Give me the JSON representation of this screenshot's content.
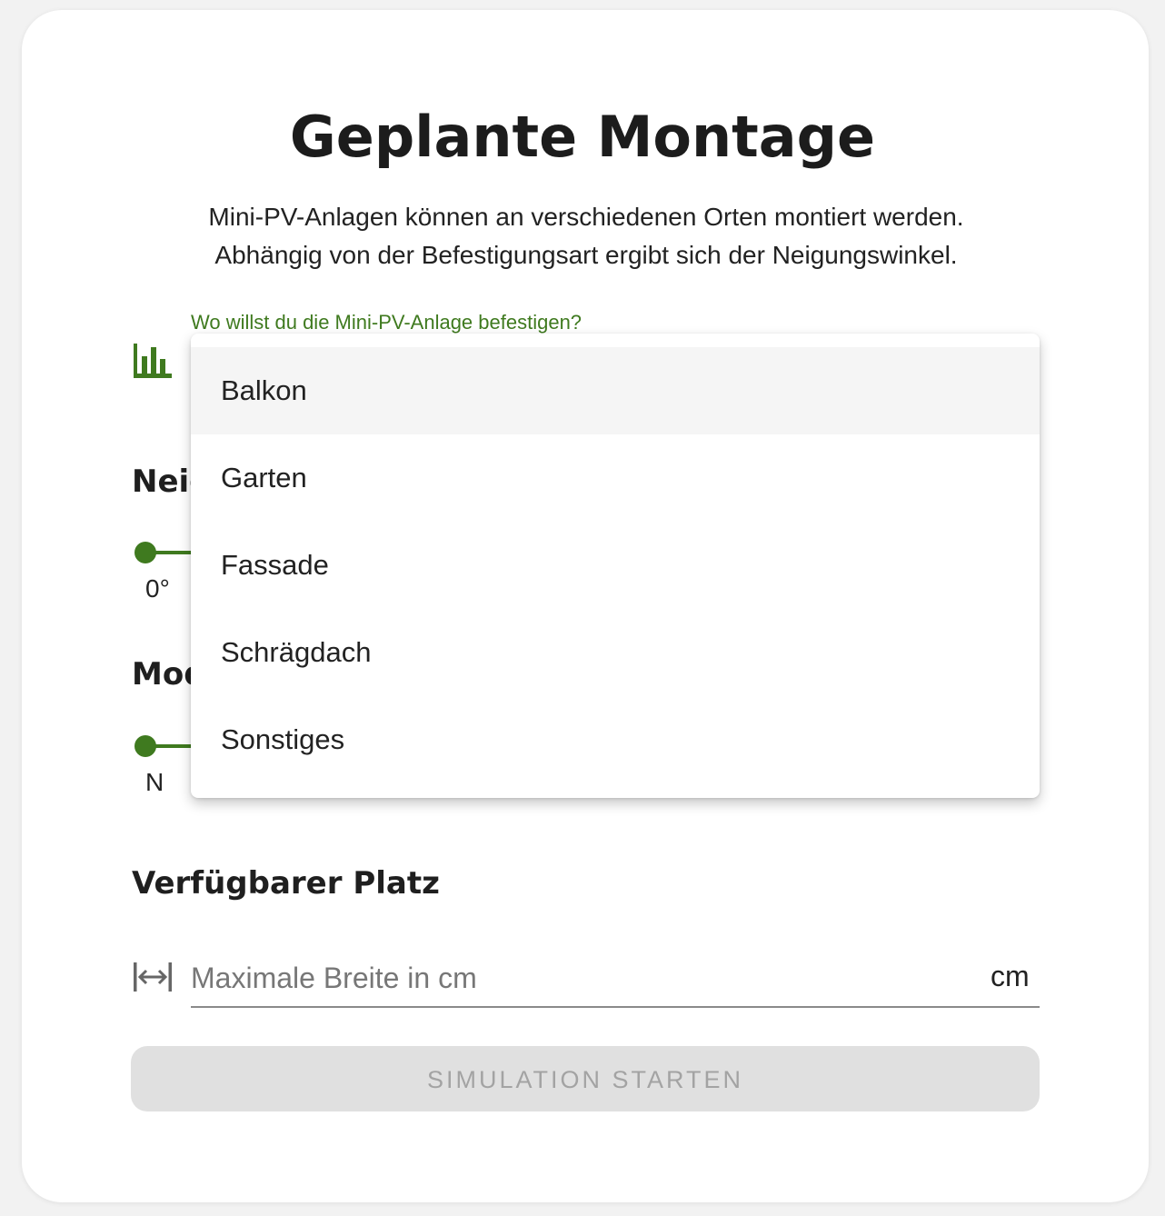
{
  "header": {
    "title": "Geplante Montage",
    "subtitle_line1": "Mini-PV-Anlagen können an verschiedenen Orten montiert werden.",
    "subtitle_line2": "Abhängig von der Befestigungsart ergibt sich der Neigungswinkel."
  },
  "mounting": {
    "label": "Wo willst du die Mini-PV-Anlage befestigen?",
    "icon": "bar-chart-icon",
    "options": [
      "Balkon",
      "Garten",
      "Fassade",
      "Schrägdach",
      "Sonstiges"
    ],
    "highlighted": "Balkon"
  },
  "tilt": {
    "heading_visible": "Neig",
    "min_label": "0°"
  },
  "orientation": {
    "heading_visible": "Mod",
    "min_label": "N"
  },
  "space": {
    "heading": "Verfügbarer Platz",
    "icon": "width-arrows-icon",
    "placeholder": "Maximale Breite in cm",
    "unit": "cm"
  },
  "actions": {
    "start_label": "SIMULATION STARTEN"
  },
  "colors": {
    "accent": "#3f7a1f",
    "button_disabled_bg": "#e0e0e0",
    "button_disabled_text": "#a3a3a3"
  }
}
